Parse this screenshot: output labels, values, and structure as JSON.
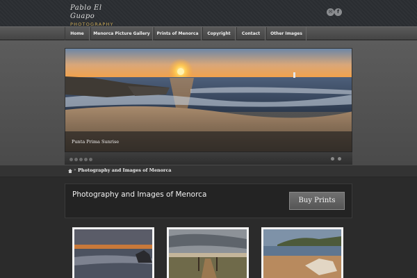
{
  "header": {
    "logo_script": "Pablo El Guapo",
    "logo_sub": "PHOTOGRAPHY",
    "social": [
      {
        "name": "mail-icon",
        "glyph": "✉"
      },
      {
        "name": "facebook-icon",
        "glyph": "f"
      }
    ]
  },
  "nav": {
    "items": [
      {
        "label": "Home"
      },
      {
        "label": "Menorca Picture Gallery"
      },
      {
        "label": "Prints of Menorca"
      },
      {
        "label": "Copyright"
      },
      {
        "label": "Contact"
      },
      {
        "label": "Other Images"
      }
    ]
  },
  "slider": {
    "caption": "Punta Prima Sunrise"
  },
  "breadcrumb": {
    "separator": "»",
    "current": "Photography and Images of Menorca"
  },
  "content": {
    "title": "Photography and Images of Menorca",
    "buy_label": "Buy Prints"
  },
  "colors": {
    "accent_gold": "#c9a855",
    "nav_bg": "#4a4a4a",
    "page_bg": "#2b2b2b"
  }
}
